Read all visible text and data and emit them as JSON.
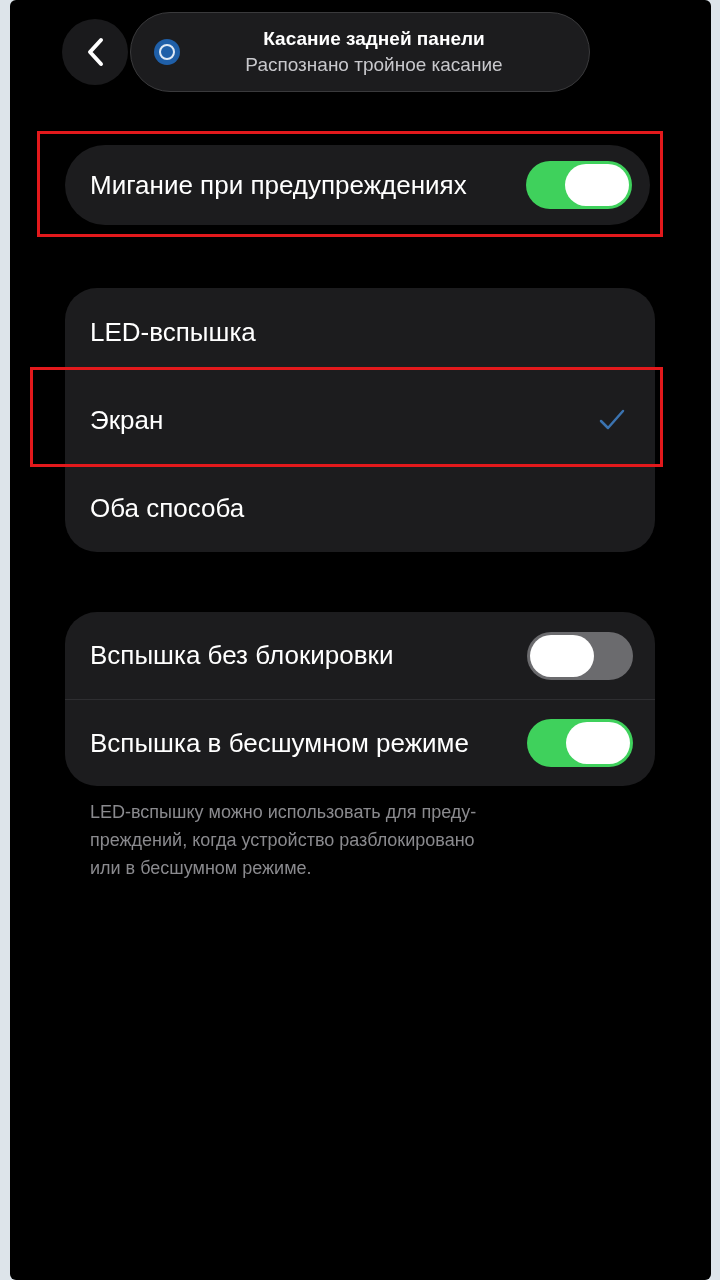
{
  "header": {
    "notification": {
      "title": "Касание задней панели",
      "subtitle": "Распознано тройное касание"
    }
  },
  "alert_flash": {
    "label": "Мигание при предупреждениях",
    "on": true,
    "highlighted": true
  },
  "options": [
    {
      "label": "LED-вспышка",
      "selected": false,
      "highlighted": false
    },
    {
      "label": "Экран",
      "selected": true,
      "highlighted": true
    },
    {
      "label": "Оба способа",
      "selected": false,
      "highlighted": false
    }
  ],
  "toggles": [
    {
      "label": "Вспышка без блокировки",
      "on": false
    },
    {
      "label": "Вспышка в бесшумном режиме",
      "on": true
    }
  ],
  "footer": "LED-вспышку можно использовать для преду-\nпреждений, когда устройство разблокировано\nили в бесшумном режиме."
}
